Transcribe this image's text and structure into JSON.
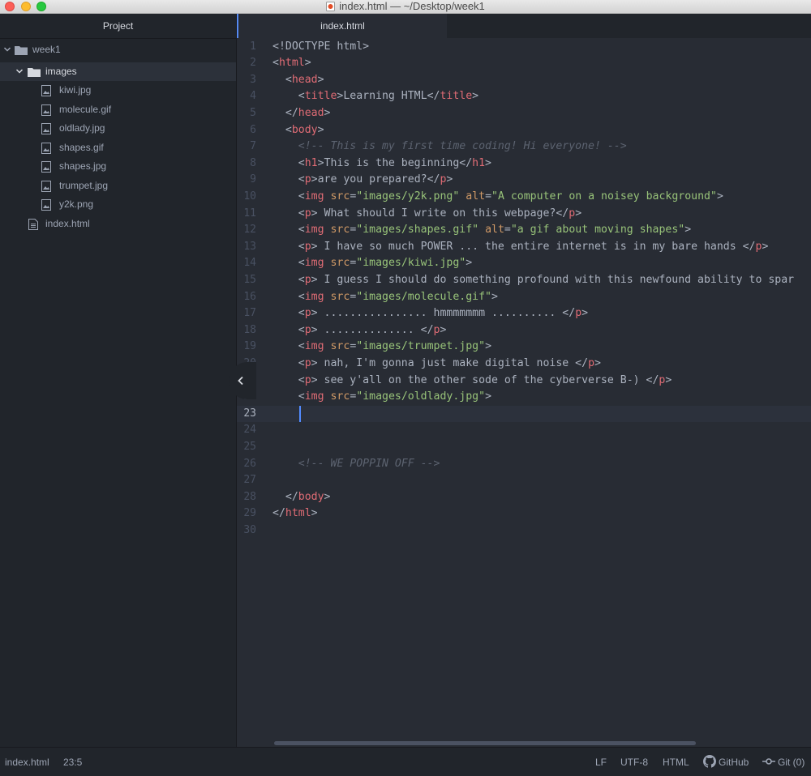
{
  "window": {
    "title": "index.html — ~/Desktop/week1"
  },
  "sidebar": {
    "header": "Project",
    "root_folder": "week1",
    "subfolder": "images",
    "image_files": [
      "kiwi.jpg",
      "molecule.gif",
      "oldlady.jpg",
      "shapes.gif",
      "shapes.jpg",
      "trumpet.jpg",
      "y2k.png"
    ],
    "root_file": "index.html"
  },
  "tab": {
    "label": "index.html"
  },
  "editor": {
    "active_line": 23,
    "lines": [
      [
        [
          "p",
          "<!DOCTYPE html>"
        ]
      ],
      [
        [
          "p",
          "<"
        ],
        [
          "t",
          "html"
        ],
        [
          "p",
          ">"
        ]
      ],
      [
        [
          "p",
          "  <"
        ],
        [
          "t",
          "head"
        ],
        [
          "p",
          ">"
        ]
      ],
      [
        [
          "p",
          "    <"
        ],
        [
          "t",
          "title"
        ],
        [
          "p",
          ">Learning HTML</"
        ],
        [
          "t",
          "title"
        ],
        [
          "p",
          ">"
        ]
      ],
      [
        [
          "p",
          "  </"
        ],
        [
          "t",
          "head"
        ],
        [
          "p",
          ">"
        ]
      ],
      [
        [
          "p",
          "  <"
        ],
        [
          "t",
          "body"
        ],
        [
          "p",
          ">"
        ]
      ],
      [
        [
          "p",
          "    "
        ],
        [
          "c",
          "<!-- This is my first time coding! Hi everyone! -->"
        ]
      ],
      [
        [
          "p",
          "    <"
        ],
        [
          "t",
          "h1"
        ],
        [
          "p",
          ">This is the beginning</"
        ],
        [
          "t",
          "h1"
        ],
        [
          "p",
          ">"
        ]
      ],
      [
        [
          "p",
          "    <"
        ],
        [
          "t",
          "p"
        ],
        [
          "p",
          ">are you prepared?</"
        ],
        [
          "t",
          "p"
        ],
        [
          "p",
          ">"
        ]
      ],
      [
        [
          "p",
          "    <"
        ],
        [
          "t",
          "img"
        ],
        [
          "p",
          " "
        ],
        [
          "a",
          "src"
        ],
        [
          "p",
          "="
        ],
        [
          "s",
          "\"images/y2k.png\""
        ],
        [
          "p",
          " "
        ],
        [
          "a",
          "alt"
        ],
        [
          "p",
          "="
        ],
        [
          "s",
          "\"A computer on a noisey background\""
        ],
        [
          "p",
          ">"
        ]
      ],
      [
        [
          "p",
          "    <"
        ],
        [
          "t",
          "p"
        ],
        [
          "p",
          "> What should I write on this webpage?</"
        ],
        [
          "t",
          "p"
        ],
        [
          "p",
          ">"
        ]
      ],
      [
        [
          "p",
          "    <"
        ],
        [
          "t",
          "img"
        ],
        [
          "p",
          " "
        ],
        [
          "a",
          "src"
        ],
        [
          "p",
          "="
        ],
        [
          "s",
          "\"images/shapes.gif\""
        ],
        [
          "p",
          " "
        ],
        [
          "a",
          "alt"
        ],
        [
          "p",
          "="
        ],
        [
          "s",
          "\"a gif about moving shapes\""
        ],
        [
          "p",
          ">"
        ]
      ],
      [
        [
          "p",
          "    <"
        ],
        [
          "t",
          "p"
        ],
        [
          "p",
          "> I have so much POWER ... the entire internet is in my bare hands </"
        ],
        [
          "t",
          "p"
        ],
        [
          "p",
          ">"
        ]
      ],
      [
        [
          "p",
          "    <"
        ],
        [
          "t",
          "img"
        ],
        [
          "p",
          " "
        ],
        [
          "a",
          "src"
        ],
        [
          "p",
          "="
        ],
        [
          "s",
          "\"images/kiwi.jpg\""
        ],
        [
          "p",
          ">"
        ]
      ],
      [
        [
          "p",
          "    <"
        ],
        [
          "t",
          "p"
        ],
        [
          "p",
          "> I guess I should do something profound with this newfound ability to spar"
        ]
      ],
      [
        [
          "p",
          "    <"
        ],
        [
          "t",
          "img"
        ],
        [
          "p",
          " "
        ],
        [
          "a",
          "src"
        ],
        [
          "p",
          "="
        ],
        [
          "s",
          "\"images/molecule.gif\""
        ],
        [
          "p",
          ">"
        ]
      ],
      [
        [
          "p",
          "    <"
        ],
        [
          "t",
          "p"
        ],
        [
          "p",
          "> ................ hmmmmmmm .......... </"
        ],
        [
          "t",
          "p"
        ],
        [
          "p",
          ">"
        ]
      ],
      [
        [
          "p",
          "    <"
        ],
        [
          "t",
          "p"
        ],
        [
          "p",
          "> .............. </"
        ],
        [
          "t",
          "p"
        ],
        [
          "p",
          ">"
        ]
      ],
      [
        [
          "p",
          "    <"
        ],
        [
          "t",
          "img"
        ],
        [
          "p",
          " "
        ],
        [
          "a",
          "src"
        ],
        [
          "p",
          "="
        ],
        [
          "s",
          "\"images/trumpet.jpg\""
        ],
        [
          "p",
          ">"
        ]
      ],
      [
        [
          "p",
          "    <"
        ],
        [
          "t",
          "p"
        ],
        [
          "p",
          "> nah, I'm gonna just make digital noise </"
        ],
        [
          "t",
          "p"
        ],
        [
          "p",
          ">"
        ]
      ],
      [
        [
          "p",
          "    <"
        ],
        [
          "t",
          "p"
        ],
        [
          "p",
          "> see y'all on the other sode of the cyberverse B-) </"
        ],
        [
          "t",
          "p"
        ],
        [
          "p",
          ">"
        ]
      ],
      [
        [
          "p",
          "    <"
        ],
        [
          "t",
          "img"
        ],
        [
          "p",
          " "
        ],
        [
          "a",
          "src"
        ],
        [
          "p",
          "="
        ],
        [
          "s",
          "\"images/oldlady.jpg\""
        ],
        [
          "p",
          ">"
        ]
      ],
      [
        [
          "p",
          "    "
        ]
      ],
      [],
      [],
      [
        [
          "p",
          "    "
        ],
        [
          "c",
          "<!-- WE POPPIN OFF -->"
        ]
      ],
      [],
      [
        [
          "p",
          "  </"
        ],
        [
          "t",
          "body"
        ],
        [
          "p",
          ">"
        ]
      ],
      [
        [
          "p",
          "</"
        ],
        [
          "t",
          "html"
        ],
        [
          "p",
          ">"
        ]
      ],
      []
    ]
  },
  "status": {
    "file": "index.html",
    "position": "23:5",
    "line_ending": "LF",
    "encoding": "UTF-8",
    "grammar": "HTML",
    "github": "GitHub",
    "git": "Git (0)"
  },
  "colors": {
    "tag": "#e06c75",
    "attr": "#d19a66",
    "string": "#98c379",
    "comment": "#5c6370",
    "plain": "#abb2bf",
    "accent": "#568af2"
  },
  "icons": {
    "folder": "folder-icon",
    "image_file": "image-file-icon",
    "file": "file-icon",
    "chevron": "chevron-down-icon",
    "collapse": "chevron-left-icon",
    "github": "github-icon",
    "git": "git-commit-icon"
  }
}
